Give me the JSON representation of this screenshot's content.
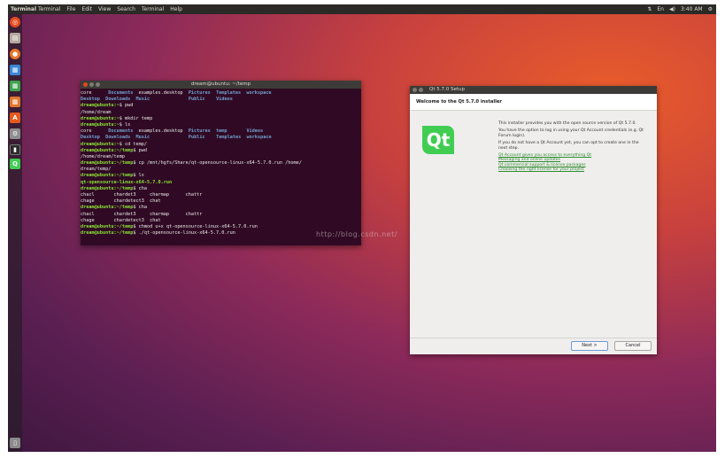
{
  "topbar": {
    "app_name": "Terminal",
    "menu": [
      "Terminal",
      "File",
      "Edit",
      "View",
      "Search",
      "Terminal",
      "Help"
    ],
    "tray": {
      "lang": "En",
      "time": "3:40 AM"
    }
  },
  "terminal": {
    "title": "dream@ubuntu: ~/temp",
    "lines": [
      [
        {
          "t": "core      "
        },
        {
          "t": "Documents",
          "c": "blue"
        },
        {
          "t": "  examples.desktop  "
        },
        {
          "t": "Pictures",
          "c": "blue"
        },
        {
          "t": "  "
        },
        {
          "t": "Templates",
          "c": "blue"
        },
        {
          "t": "  "
        },
        {
          "t": "workspace",
          "c": "blue"
        }
      ],
      [
        {
          "t": "Desktop",
          "c": "blue"
        },
        {
          "t": "  "
        },
        {
          "t": "Downloads",
          "c": "blue"
        },
        {
          "t": "  "
        },
        {
          "t": "Music",
          "c": "blue"
        },
        {
          "t": "              "
        },
        {
          "t": "Public",
          "c": "blue"
        },
        {
          "t": "    "
        },
        {
          "t": "Videos",
          "c": "blue"
        }
      ],
      [
        {
          "t": "dream@ubuntu:~",
          "c": "prompt"
        },
        {
          "t": "$ pwd"
        }
      ],
      [
        {
          "t": "/home/dream"
        }
      ],
      [
        {
          "t": "dream@ubuntu:~",
          "c": "prompt"
        },
        {
          "t": "$ mkdir temp"
        }
      ],
      [
        {
          "t": "dream@ubuntu:~",
          "c": "prompt"
        },
        {
          "t": "$ ls"
        }
      ],
      [
        {
          "t": "core      "
        },
        {
          "t": "Documents",
          "c": "blue"
        },
        {
          "t": "  examples.desktop  "
        },
        {
          "t": "Pictures",
          "c": "blue"
        },
        {
          "t": "  "
        },
        {
          "t": "temp",
          "c": "blue"
        },
        {
          "t": "       "
        },
        {
          "t": "Videos",
          "c": "blue"
        }
      ],
      [
        {
          "t": "Desktop",
          "c": "blue"
        },
        {
          "t": "  "
        },
        {
          "t": "Downloads",
          "c": "blue"
        },
        {
          "t": "  "
        },
        {
          "t": "Music",
          "c": "blue"
        },
        {
          "t": "              "
        },
        {
          "t": "Public",
          "c": "blue"
        },
        {
          "t": "    "
        },
        {
          "t": "Templates",
          "c": "blue"
        },
        {
          "t": "  "
        },
        {
          "t": "workspace",
          "c": "blue"
        }
      ],
      [
        {
          "t": "dream@ubuntu:~",
          "c": "prompt"
        },
        {
          "t": "$ cd temp/"
        }
      ],
      [
        {
          "t": "dream@ubuntu:~/temp",
          "c": "prompt"
        },
        {
          "t": "$ pwd"
        }
      ],
      [
        {
          "t": "/home/dream/temp"
        }
      ],
      [
        {
          "t": "dream@ubuntu:~/temp",
          "c": "prompt"
        },
        {
          "t": "$ cp /mnt/hgfs/Share/qt-opensource-linux-x64-5.7.0.run /home/"
        }
      ],
      [
        {
          "t": "dream/temp/"
        }
      ],
      [
        {
          "t": "dream@ubuntu:~/temp",
          "c": "prompt"
        },
        {
          "t": "$ ls"
        }
      ],
      [
        {
          "t": "qt-opensource-linux-x64-5.7.0.run",
          "c": "green"
        }
      ],
      [
        {
          "t": "dream@ubuntu:~/temp",
          "c": "prompt"
        },
        {
          "t": "$ cha"
        }
      ],
      [
        {
          "t": "chacl       chardet3     charmap      chattr"
        }
      ],
      [
        {
          "t": "chage       chardetect3  chat"
        }
      ],
      [
        {
          "t": "dream@ubuntu:~/temp",
          "c": "prompt"
        },
        {
          "t": "$ cha"
        }
      ],
      [
        {
          "t": "chacl       chardet3     charmap      chattr"
        }
      ],
      [
        {
          "t": "chage       chardetect3  chat"
        }
      ],
      [
        {
          "t": "dream@ubuntu:~/temp",
          "c": "prompt"
        },
        {
          "t": "$ chmod u+x qt-opensource-linux-x64-5.7.0.run"
        }
      ],
      [
        {
          "t": "dream@ubuntu:~/temp",
          "c": "prompt"
        },
        {
          "t": "$ ./qt-opensource-linux-x64-5.7.0.run"
        }
      ]
    ]
  },
  "watermark": "http://blog.csdn.net/",
  "qt_installer": {
    "title": "Qt 5.7.0 Setup",
    "header": "Welcome to the Qt 5.7.0 installer",
    "logo_text": "Qt",
    "paragraphs": [
      "This installer provides you with the open source version of Qt 5.7.0.",
      "You have the option to log in using your Qt Account credentials (e.g. Qt Forum login).",
      "If you do not have a Qt Account yet, you can opt to create one in the next step."
    ],
    "links": [
      "Qt Account gives you access to everything Qt",
      "Messaging and online updates",
      "Qt commercial support & license packages",
      "Choosing the right license for your project"
    ],
    "next_button": "Next >",
    "cancel_button": "Cancel"
  },
  "colors": {
    "terminal_bg": "#300a24",
    "prompt": "#8ae234",
    "dir": "#729fcf",
    "qt_green": "#41cd52"
  }
}
